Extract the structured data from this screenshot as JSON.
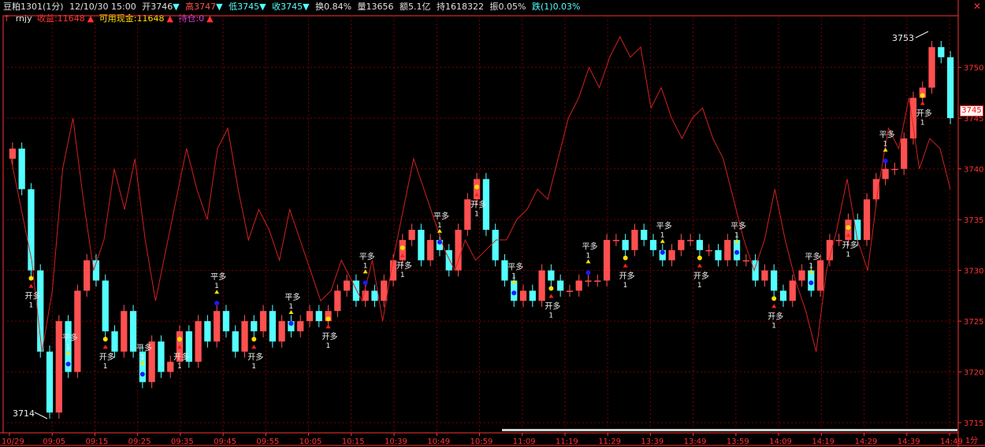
{
  "header": {
    "symbol": "豆粕1301",
    "period": "(1分)",
    "datetime": "12/10/30 15:00",
    "open_label": "开3746",
    "open_arrow": "▼",
    "high_label": "高3747",
    "high_arrow": "▼",
    "low_label": "低3745",
    "low_arrow": "▼",
    "close_label": "收3745",
    "close_arrow": "▼",
    "turnover": "换0.84%",
    "volume": "量13656",
    "amount": "额5.1亿",
    "holding": "持1618322",
    "amplitude": "振0.05%",
    "change": "跌(1)0.03%"
  },
  "indicator": {
    "name": "rnjy",
    "profit": "收益:11648",
    "cash": "可用现金:11648",
    "position": "持仓:0"
  },
  "colors": {
    "up": "#ff5050",
    "down": "#54ffff",
    "line": "#d42020",
    "grid": "#7a0000",
    "axis": "#ff3333",
    "buy_marker": "#ffe000",
    "sell_marker": "#1a1aff"
  },
  "chart_data": {
    "type": "candlestick",
    "ylim": [
      3714,
      3754
    ],
    "y_ticks": [
      "3750",
      "3745",
      "3740",
      "3735",
      "3730",
      "3725",
      "3720",
      "3715"
    ],
    "x_ticks": [
      "10/29",
      "09:05",
      "09:15",
      "09:25",
      "09:35",
      "09:45",
      "09:55",
      "10:05",
      "10:15",
      "10:39",
      "10:49",
      "10:59",
      "11:09",
      "11:19",
      "11:29",
      "13:39",
      "13:49",
      "13:59",
      "14:09",
      "14:19",
      "14:29",
      "14:39",
      "14:49"
    ],
    "last_price": "3745",
    "annotations": {
      "high": "3753",
      "low": "3714"
    },
    "signal_text": {
      "open": "开多",
      "close": "平多",
      "qty": "1"
    },
    "close_prices": [
      3742,
      3738,
      3730,
      3722,
      3716,
      3725,
      3720,
      3728,
      3731,
      3729,
      3724,
      3722,
      3726,
      3722,
      3719,
      3723,
      3720,
      3721,
      3724,
      3721,
      3725,
      3723,
      3726,
      3724,
      3722,
      3725,
      3724,
      3726,
      3723,
      3725,
      3724,
      3725,
      3726,
      3725,
      3726,
      3728,
      3729,
      3727,
      3728,
      3727,
      3729,
      3731,
      3733,
      3734,
      3731,
      3733,
      3732,
      3730,
      3734,
      3737,
      3739,
      3734,
      3731,
      3729,
      3727,
      3728,
      3727,
      3730,
      3729,
      3728,
      3728,
      3729,
      3729,
      3729,
      3733,
      3733,
      3732,
      3734,
      3733,
      3732,
      3731,
      3732,
      3733,
      3733,
      3732,
      3732,
      3731,
      3733,
      3731,
      3731,
      3729,
      3730,
      3728,
      3727,
      3729,
      3730,
      3728,
      3731,
      3733,
      3733,
      3735,
      3733,
      3737,
      3739,
      3740,
      3740,
      3743,
      3747,
      3748,
      3752,
      3751,
      3745
    ],
    "red_line": [
      3741,
      3736,
      3731,
      3722,
      3728,
      3740,
      3745,
      3737,
      3730,
      3733,
      3740,
      3736,
      3741,
      3733,
      3727,
      3732,
      3737,
      3742,
      3738,
      3735,
      3742,
      3744,
      3738,
      3733,
      3736,
      3734,
      3731,
      3736,
      3733,
      3730,
      3727,
      3728,
      3731,
      3729,
      3727,
      3731,
      3725,
      3731,
      3736,
      3741,
      3738,
      3735,
      3732,
      3730,
      3733,
      3731,
      3732,
      3733,
      3733,
      3735,
      3736,
      3738,
      3737,
      3741,
      3745,
      3747,
      3750,
      3748,
      3751,
      3753,
      3751,
      3752,
      3746,
      3748,
      3745,
      3743,
      3745,
      3746,
      3743,
      3741,
      3737,
      3733,
      3730,
      3733,
      3738,
      3733,
      3729,
      3726,
      3722,
      3730,
      3734,
      3739,
      3733,
      3730,
      3738,
      3744,
      3742,
      3747,
      3740,
      3743,
      3742,
      3738
    ]
  },
  "footer": {
    "period_button": "1分"
  }
}
